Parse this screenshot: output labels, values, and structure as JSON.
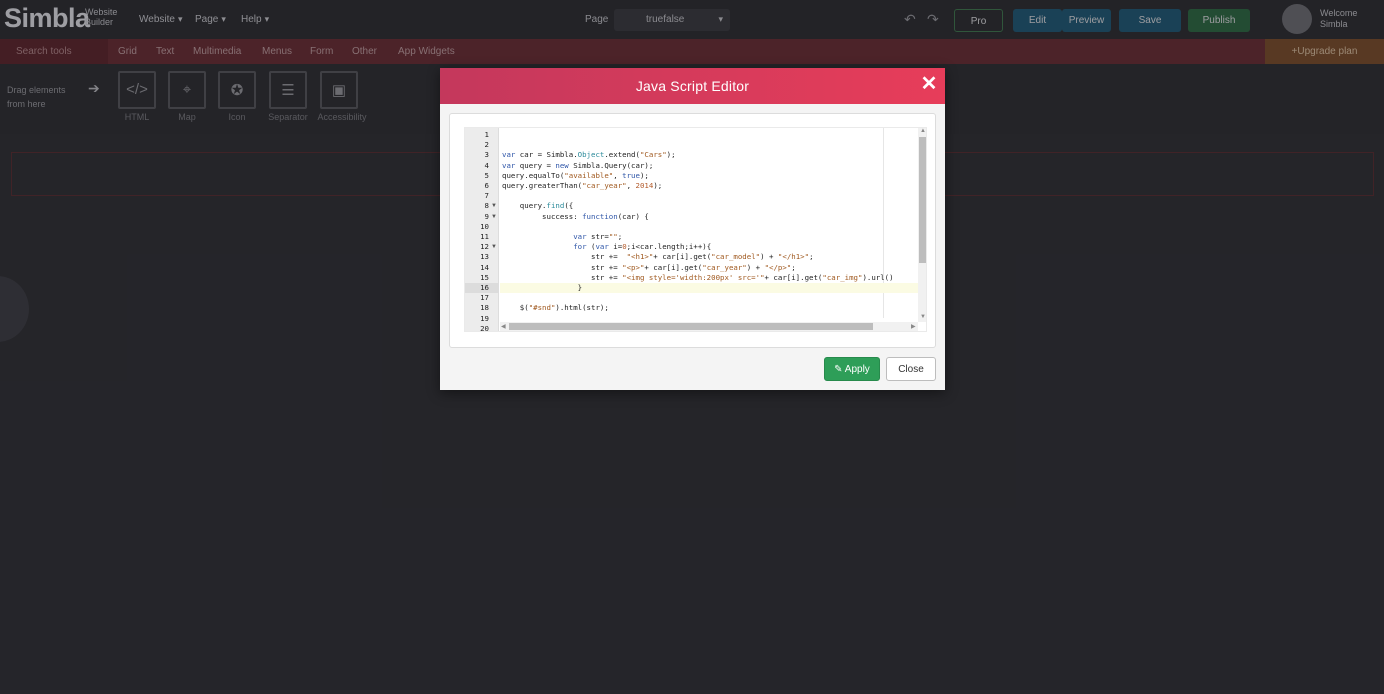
{
  "topbar": {
    "logo": "Simbla",
    "logo_sub": "Website Builder",
    "menus": [
      "Website",
      "Page",
      "Help"
    ],
    "page_label": "Page",
    "page_select_value": "truefalse",
    "pro_label": "Pro",
    "edit_label": "Edit",
    "preview_label": "Preview",
    "save_label": "Save",
    "publish_label": "Publish",
    "welcome": "Welcome",
    "user": "Simbla"
  },
  "categories": {
    "search_placeholder": "Search tools",
    "items": [
      "Grid",
      "Text",
      "Multimedia",
      "Menus",
      "Form",
      "Other",
      "App Widgets"
    ],
    "upgrade": "+Upgrade plan"
  },
  "palette": {
    "hint": "Drag elements from here",
    "elements": [
      {
        "label": "HTML",
        "icon": "code-icon"
      },
      {
        "label": "Map",
        "icon": "map-pin-icon"
      },
      {
        "label": "Icon",
        "icon": "star-icon"
      },
      {
        "label": "Separator",
        "icon": "separator-icon"
      },
      {
        "label": "Accessibility",
        "icon": "accessibility-icon"
      }
    ]
  },
  "modal": {
    "title": "Java Script Editor",
    "apply_label": "Apply",
    "close_label": "Close",
    "editor": {
      "active_line": 16,
      "line_numbers": [
        "1",
        "2",
        "3",
        "4",
        "5",
        "6",
        "7",
        "8",
        "9",
        "10",
        "11",
        "12",
        "13",
        "14",
        "15",
        "16",
        "17",
        "18",
        "19",
        "20"
      ],
      "folded_lines": [
        8,
        9,
        12
      ],
      "lines": [
        "",
        "",
        "var car = Simbla.Object.extend(\"Cars\");",
        "var query = new Simbla.Query(car);",
        "query.equalTo(\"available\", true);",
        "query.greaterThan(\"car_year\", 2014);",
        "",
        "    query.find({",
        "         success: function(car) {",
        "",
        "                var str=\"\";",
        "                for (var i=0;i<car.length;i++){",
        "                    str +=  \"<h1>\"+ car[i].get(\"car_model\") + \"</h1>\";",
        "                    str += \"<p>\"+ car[i].get(\"car_year\") + \"</p>\";",
        "                    str += \"<img style='width:200px' src='\"+ car[i].get(\"car_img\").url()",
        "                 }",
        "",
        "    $(\"#snd\").html(str);",
        "",
        ""
      ]
    }
  }
}
